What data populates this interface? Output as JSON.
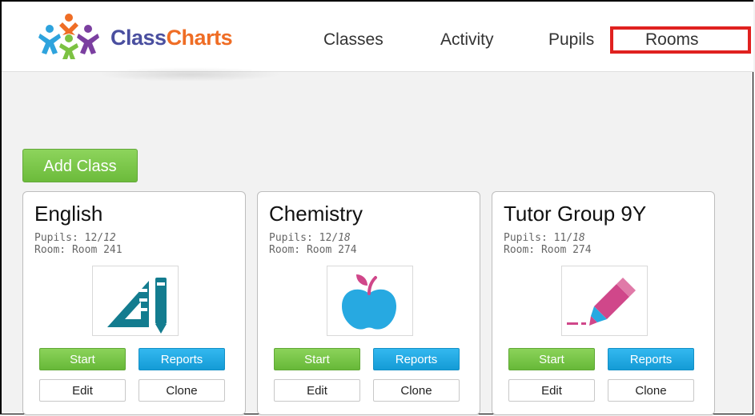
{
  "app": {
    "logo_part1": "Class",
    "logo_part2": "Charts"
  },
  "nav": {
    "items": [
      {
        "label": "Classes"
      },
      {
        "label": "Activity"
      },
      {
        "label": "Pupils"
      },
      {
        "label": "Rooms"
      }
    ],
    "highlighted": "Rooms"
  },
  "toolbar": {
    "add_class_label": "Add Class"
  },
  "classes": [
    {
      "name": "English",
      "pupils_label": "Pupils:",
      "pupils_present": "12",
      "pupils_total": "12",
      "room_label": "Room:",
      "room": "Room 241",
      "icon": "ruler-pencil-icon",
      "start_label": "Start",
      "reports_label": "Reports",
      "edit_label": "Edit",
      "clone_label": "Clone"
    },
    {
      "name": "Chemistry",
      "pupils_label": "Pupils:",
      "pupils_present": "12",
      "pupils_total": "18",
      "room_label": "Room:",
      "room": "Room 274",
      "icon": "apple-icon",
      "start_label": "Start",
      "reports_label": "Reports",
      "edit_label": "Edit",
      "clone_label": "Clone"
    },
    {
      "name": "Tutor Group 9Y",
      "pupils_label": "Pupils:",
      "pupils_present": "11",
      "pupils_total": "18",
      "room_label": "Room:",
      "room": "Room 274",
      "icon": "highlighter-icon",
      "start_label": "Start",
      "reports_label": "Reports",
      "edit_label": "Edit",
      "clone_label": "Clone"
    }
  ],
  "colors": {
    "brand_purple": "#4a4f9f",
    "brand_orange": "#ef6d25",
    "start_green": "#6cbb3b",
    "reports_blue": "#149bd6",
    "highlight_red": "#e0211f"
  }
}
